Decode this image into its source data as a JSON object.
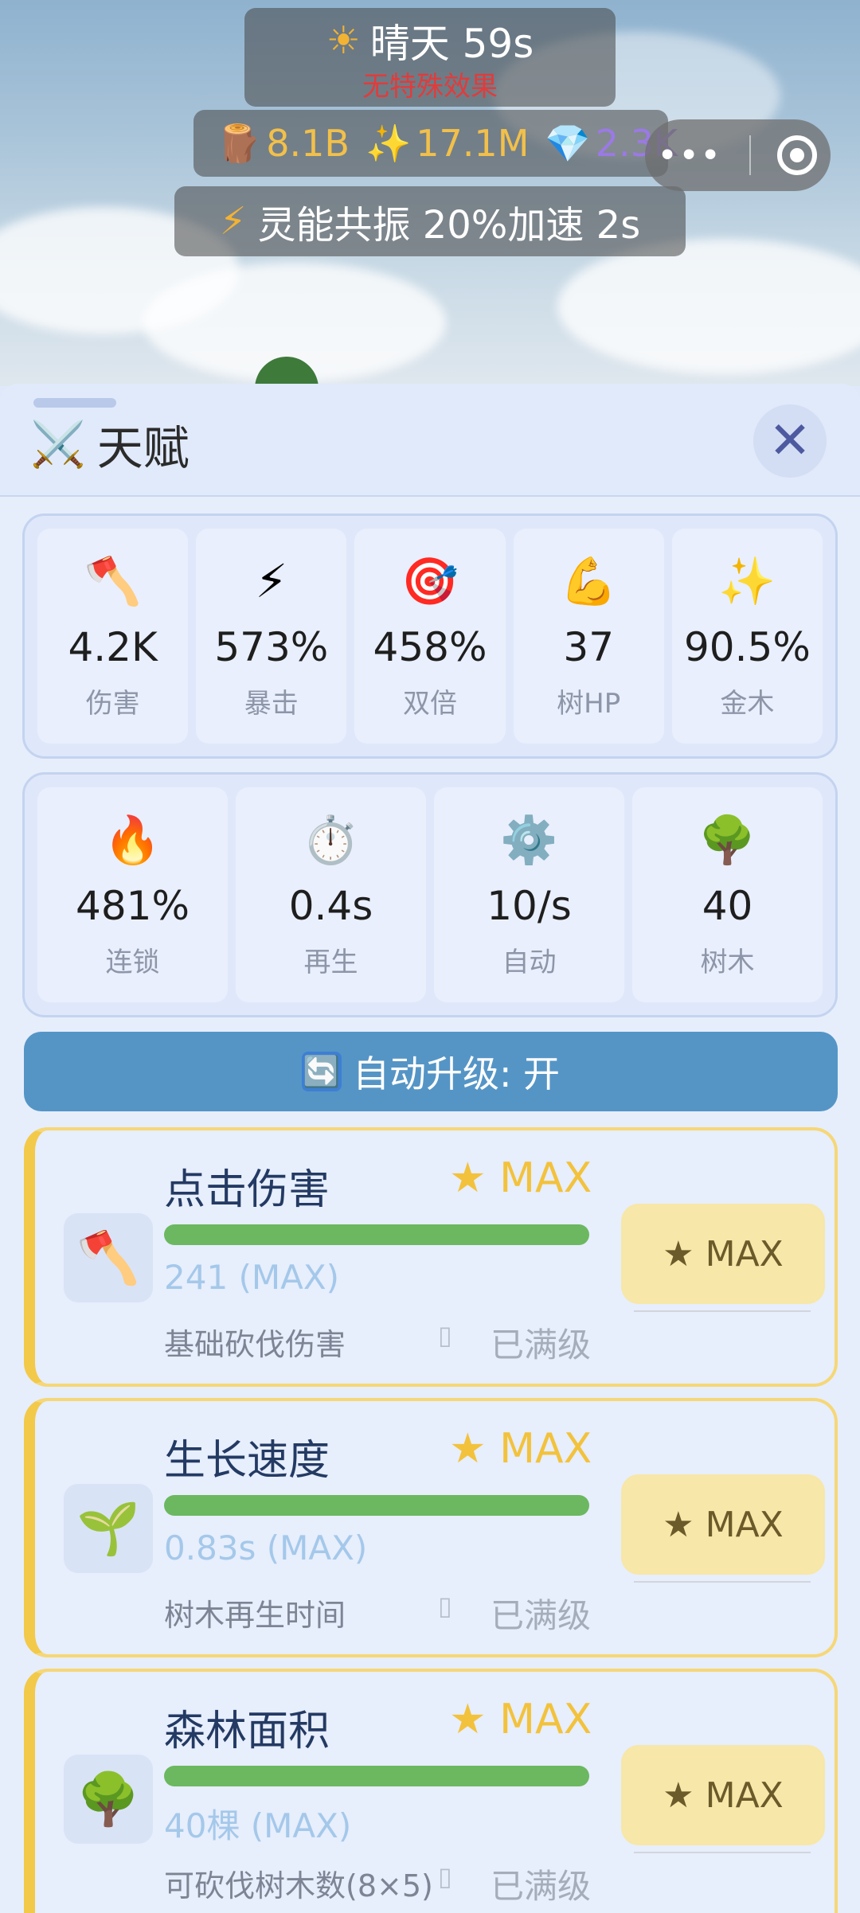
{
  "hud": {
    "weather": {
      "icon": "☀",
      "text": "晴天 59s",
      "effect": "无特殊效果"
    },
    "resources": [
      {
        "icon": "🪵",
        "value": "8.1B"
      },
      {
        "icon": "✨",
        "value": "17.1M"
      },
      {
        "icon": "💎",
        "value": "2.3K"
      }
    ],
    "buff": {
      "icon": "⚡",
      "text": "灵能共振 20%加速 2s"
    },
    "capsule": {
      "more": "•••"
    }
  },
  "panel": {
    "title_icon": "⚔️",
    "title": "天赋",
    "close_icon": "✕"
  },
  "stats_row1": [
    {
      "icon": "🪓",
      "value": "4.2K",
      "label": "伤害"
    },
    {
      "icon": "⚡",
      "value": "573%",
      "label": "暴击"
    },
    {
      "icon": "🎯",
      "value": "458%",
      "label": "双倍"
    },
    {
      "icon": "💪",
      "value": "37",
      "label": "树HP"
    },
    {
      "icon": "✨",
      "value": "90.5%",
      "label": "金木"
    }
  ],
  "stats_row2": [
    {
      "icon": "🔥",
      "value": "481%",
      "label": "连锁"
    },
    {
      "icon": "⏱️",
      "value": "0.4s",
      "label": "再生"
    },
    {
      "icon": "⚙️",
      "value": "10/s",
      "label": "自动"
    },
    {
      "icon": "🌳",
      "value": "40",
      "label": "树木"
    }
  ],
  "auto_upgrade": {
    "icon": "🔄",
    "label": "自动升级: 开"
  },
  "upgrades": [
    {
      "icon": "🪓",
      "name": "点击伤害",
      "badge": "★ MAX",
      "level": "241 (MAX)",
      "desc": "基础砍伐伤害",
      "mini": "▯",
      "status": "已满级",
      "button": "★ MAX",
      "progress": 1.0
    },
    {
      "icon": "🌱",
      "name": "生长速度",
      "badge": "★ MAX",
      "level": "0.83s (MAX)",
      "desc": "树木再生时间",
      "mini": "▯",
      "status": "已满级",
      "button": "★ MAX",
      "progress": 1.0
    },
    {
      "icon": "🌳",
      "name": "森林面积",
      "badge": "★ MAX",
      "level": "40棵 (MAX)",
      "desc": "可砍伐树木数(8×5)",
      "mini": "▯",
      "status": "已满级",
      "button": "★ MAX",
      "progress": 1.0
    }
  ]
}
